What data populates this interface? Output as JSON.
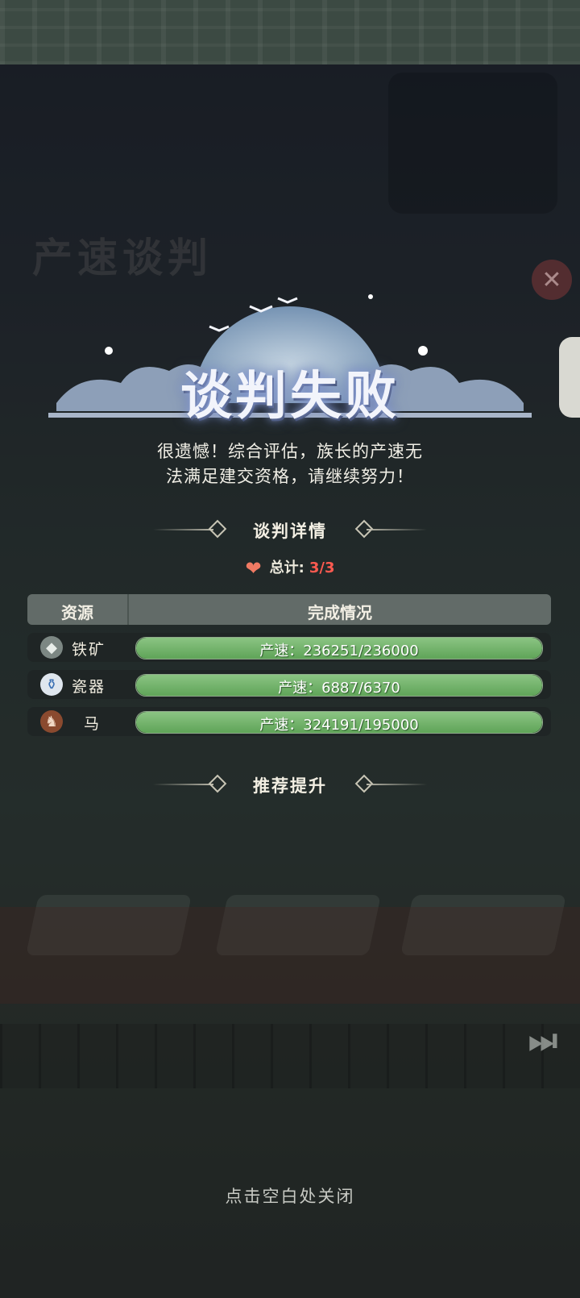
{
  "background": {
    "screen_title_ghost": "产速谈判"
  },
  "popup": {
    "title": "谈判失败",
    "message_line1": "很遗憾！综合评估，族长的产速无",
    "message_line2": "法满足建交资格，请继续努力！",
    "details_header": "谈判详情",
    "total_label": "总计:",
    "total_value": "3/3",
    "table": {
      "col_resource": "资源",
      "col_status": "完成情况",
      "rows": [
        {
          "icon": "iron-ore-icon",
          "name": "铁矿",
          "status": "产速：236251/236000",
          "progress": 1.0
        },
        {
          "icon": "porcelain-vase-icon",
          "name": "瓷器",
          "status": "产速：6887/6370",
          "progress": 1.0
        },
        {
          "icon": "horse-icon",
          "name": "马",
          "status": "产速：324191/195000",
          "progress": 1.0
        }
      ]
    },
    "recommend_header": "推荐提升",
    "close_hint": "点击空白处关闭"
  },
  "colors": {
    "progress_fill": "#6fb267",
    "total_value": "#ff5a50",
    "heart": "#f07a63"
  }
}
